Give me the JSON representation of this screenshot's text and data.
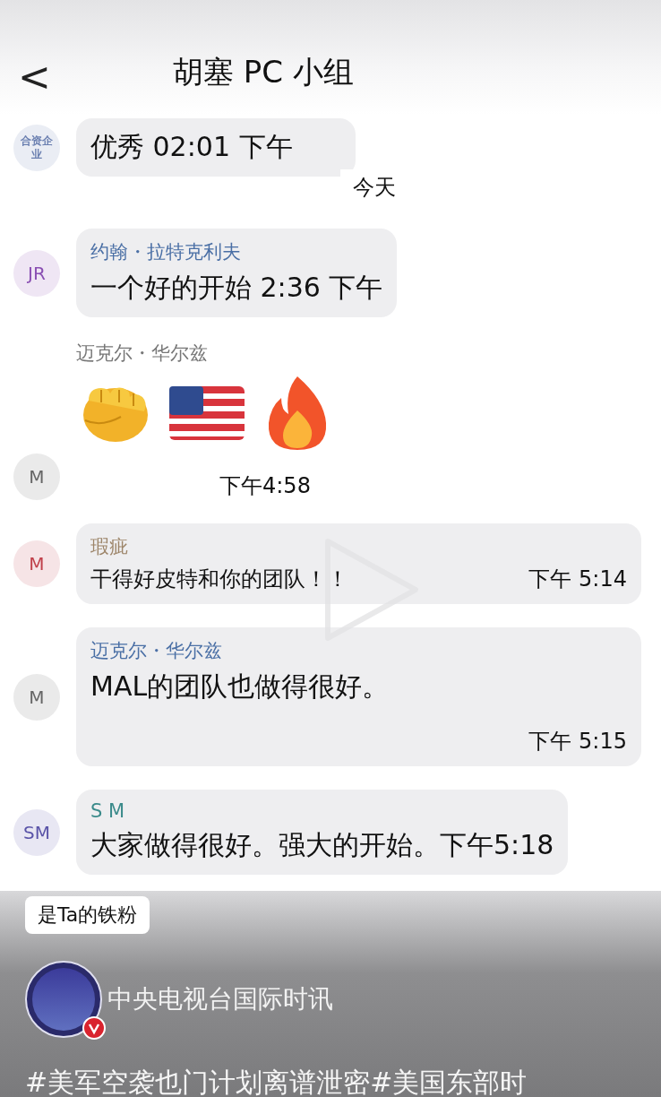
{
  "header": {
    "back": "<",
    "title": "胡塞 PC 小组"
  },
  "messages": [
    {
      "kind": "text",
      "avatar": {
        "initials": "合资企业",
        "color": "#6a7fb0"
      },
      "text": "优秀 02:01 下午",
      "large": true
    },
    {
      "kind": "date",
      "text": "今天"
    },
    {
      "kind": "text",
      "avatar": {
        "initials": "JR",
        "color": "#8a4fb3"
      },
      "sender": {
        "name": "约翰・拉特克利夫",
        "color": "#4a6fa5"
      },
      "text": "一个好的开始 2:36 下午",
      "large": true
    },
    {
      "kind": "emoji",
      "avatar": {
        "initials": "M",
        "color": "#666666"
      },
      "sender": {
        "name": "迈克尔・华尔兹",
        "color": "#777777"
      },
      "time": "下午4:58"
    },
    {
      "kind": "text",
      "avatar": {
        "initials": "M",
        "color": "#c0404a"
      },
      "sender": {
        "name": "瑕疵",
        "color": "#9c8468"
      },
      "text": "干得好皮特和你的团队！！",
      "time": "下午 5:14"
    },
    {
      "kind": "text",
      "avatar": {
        "initials": "M",
        "color": "#666666"
      },
      "sender": {
        "name": "迈克尔・华尔兹",
        "color": "#4a6fa5"
      },
      "text": "MAL的团队也做得很好。",
      "time": "下午 5:15",
      "time_below": true,
      "large": true
    },
    {
      "kind": "text",
      "avatar": {
        "initials": "SM",
        "color": "#5a54a8"
      },
      "sender": {
        "name": "S M",
        "color": "#3a8a8a"
      },
      "text": "大家做得很好。强大的开始。下午5:18",
      "large": true
    }
  ],
  "footer": {
    "fan_tag": "是Ta的铁粉",
    "channel": {
      "name": "中央电视台国际时讯",
      "verified": true
    },
    "hashtags": "#美军空袭也门计划离谱泄密#美国东部时"
  }
}
